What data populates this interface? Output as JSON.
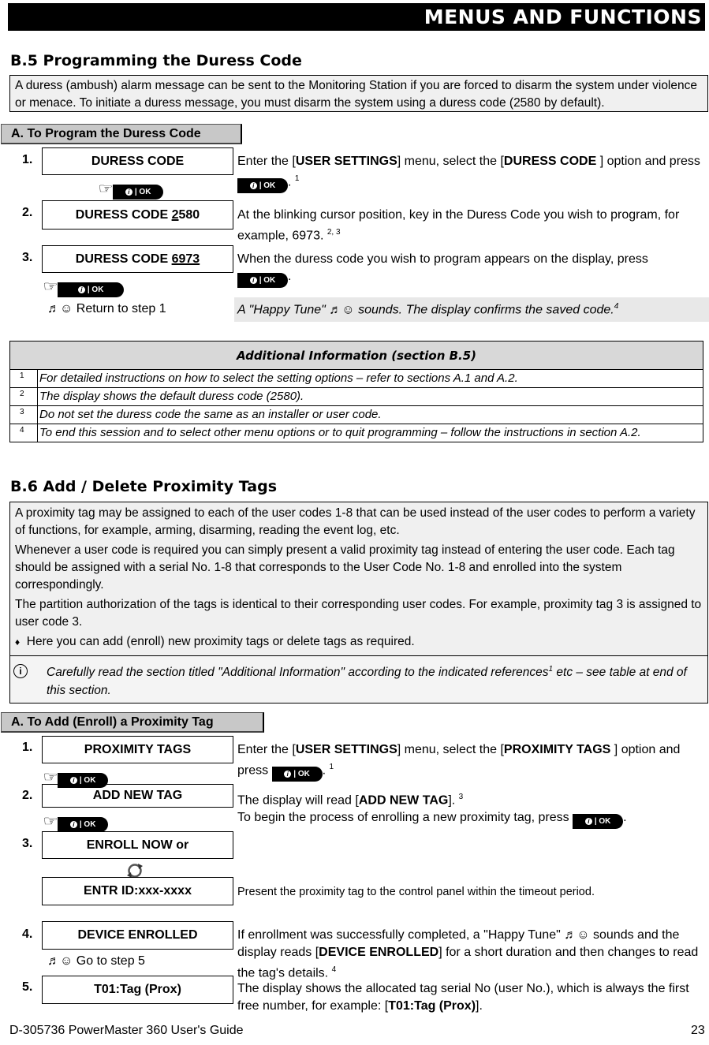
{
  "header": {
    "title": "MENUS AND FUNCTIONS"
  },
  "b5": {
    "title": "B.5 Programming the Duress Code",
    "intro": "A duress (ambush) alarm message can be sent to the Monitoring Station if you are forced to disarm the system under violence or menace. To initiate a duress message, you must disarm the system using a duress code (2580 by default).",
    "subheader": "A. To Program the Duress Code",
    "button_label": "OK",
    "steps": [
      {
        "num": "1.",
        "display": "DURESS CODE",
        "desc_parts": [
          "Enter the [",
          "USER SETTINGS",
          "] menu, select the [",
          "DURESS CODE",
          "] option and press",
          ".",
          "1"
        ]
      },
      {
        "num": "2.",
        "display_prefix": "DURESS CODE ",
        "display_underlined": "2",
        "display_suffix": "580",
        "desc": "At the blinking cursor position, key in the Duress Code you wish to program, for example, 6973.",
        "desc_sup": "2, 3"
      },
      {
        "num": "3.",
        "display_prefix": "DURESS CODE ",
        "display_underlined": "6973",
        "desc": "When the duress code you wish to program appears on the display, press"
      }
    ],
    "return_note": "♬☺ Return to step 1",
    "tune_note": "A \"Happy Tune\" ♬☺ sounds. The display confirms the saved code.",
    "tune_sup": "4"
  },
  "b5_info": {
    "title": "Additional Information (section B.5)",
    "rows": [
      {
        "ref": "1",
        "text": "For detailed instructions on how to select the setting options – refer to sections A.1 and A.2."
      },
      {
        "ref": "2",
        "text": "The display shows the default duress code (2580)."
      },
      {
        "ref": "3",
        "text": "Do not set the duress code the same as an installer or user code."
      },
      {
        "ref": "4",
        "text": "To end this session and to select other menu options or to quit programming – follow the instructions in section A.2."
      }
    ]
  },
  "b6": {
    "title": "B.6 Add / Delete Proximity Tags",
    "paragraphs": [
      "A proximity tag may be assigned to each of the user codes 1-8 that can be used instead of the user codes to perform a variety of functions, for example, arming, disarming, reading the event log, etc.",
      "Whenever a user code is required you can simply present a valid proximity tag instead of entering the user code. Each tag should be assigned with a serial No. 1-8  that corresponds to the User Code No. 1-8 and enrolled into the system correspondingly.",
      "The partition authorization of the tags is identical to their corresponding user codes. For example, proximity tag 3 is assigned to user code 3."
    ],
    "bullet": "Here you can add (enroll) new proximity tags or delete tags as required.",
    "note": "Carefully read the section titled \"Additional Information\" according to the indicated references",
    "note_sup": "1",
    "note_end": " etc – see table at end of this section.",
    "subheader": "A. To Add (Enroll) a Proximity Tag",
    "steps": [
      {
        "num": "1.",
        "display": "PROXIMITY TAGS",
        "desc_parts": [
          "Enter the [",
          "USER SETTINGS",
          "] menu, select the [",
          "PROXIMITY TAGS",
          "] option and press",
          ".",
          "1"
        ]
      },
      {
        "num": "2.",
        "display": "ADD NEW TAG",
        "desc_parts": [
          "The display will read [",
          "ADD NEW TAG",
          "].",
          "3"
        ],
        "desc_line2": "To begin the process of enrolling a new proximity tag, press"
      },
      {
        "num": "3.",
        "display": "ENROLL NOW or",
        "display_alt": "ENTR ID:xxx-xxxx",
        "desc": "Present the proximity tag to the control panel within the timeout period."
      },
      {
        "num": "4.",
        "display": "DEVICE ENROLLED",
        "desc_parts": [
          "If enrollment was successfully completed, a \"Happy Tune\" ♬☺ sounds and the display reads [",
          "DEVICE ENROLLED",
          "] for a short duration and then changes to read the tag's details.",
          "4"
        ],
        "note": "♬☺ Go to step 5"
      },
      {
        "num": "5.",
        "display": "T01:Tag (Prox)",
        "desc_parts": [
          "The display shows the allocated tag serial No (user No.), which is always the first free number, for example: [",
          "T01:Tag (Prox)",
          "]."
        ]
      }
    ]
  },
  "footer": {
    "doc": "D-305736 PowerMaster 360 User's Guide",
    "page": "23"
  }
}
